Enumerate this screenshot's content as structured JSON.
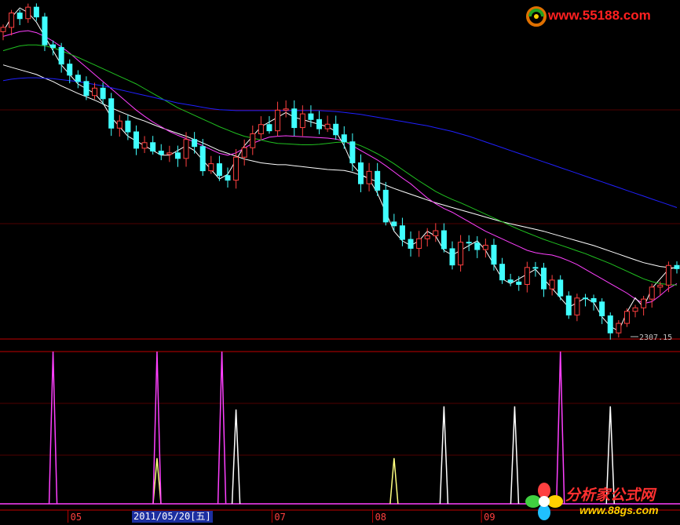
{
  "chart_data": [
    {
      "type": "candlestick",
      "low_label": "2307.15",
      "x_ticks": [
        {
          "label": "05",
          "pos": 0.1
        },
        {
          "label": "07",
          "pos": 0.4
        },
        {
          "label": "08",
          "pos": 0.548
        },
        {
          "label": "09",
          "pos": 0.708
        }
      ],
      "moving_averages": [
        {
          "color": "#ffffff",
          "values": [
            2870,
            2865,
            2860,
            2855,
            2850,
            2842,
            2835,
            2826,
            2818,
            2810,
            2803,
            2796,
            2788,
            2780,
            2772,
            2765,
            2758,
            2752,
            2745,
            2738,
            2732,
            2726,
            2720,
            2713,
            2706,
            2698,
            2690,
            2684,
            2678,
            2672,
            2668,
            2664,
            2662,
            2660,
            2660,
            2658,
            2656,
            2654,
            2652,
            2650,
            2649,
            2648,
            2644,
            2638,
            2631,
            2624,
            2617,
            2610,
            2604,
            2598,
            2592,
            2586,
            2580,
            2575,
            2570,
            2565,
            2560,
            2555,
            2550,
            2545,
            2540,
            2536,
            2532,
            2528,
            2524,
            2520,
            2515,
            2510,
            2505,
            2500,
            2495,
            2490,
            2484,
            2478,
            2472,
            2466,
            2460,
            2454,
            2450,
            2446,
            2444,
            2442
          ]
        },
        {
          "color": "#ff40ff",
          "values": [
            2930,
            2935,
            2940,
            2942,
            2938,
            2930,
            2920,
            2908,
            2895,
            2880,
            2865,
            2850,
            2835,
            2820,
            2805,
            2790,
            2775,
            2762,
            2750,
            2740,
            2730,
            2722,
            2715,
            2708,
            2700,
            2692,
            2684,
            2680,
            2685,
            2695,
            2705,
            2712,
            2718,
            2720,
            2721,
            2720,
            2719,
            2718,
            2717,
            2716,
            2714,
            2710,
            2700,
            2690,
            2680,
            2670,
            2658,
            2645,
            2632,
            2620,
            2605,
            2590,
            2578,
            2568,
            2560,
            2550,
            2540,
            2530,
            2520,
            2512,
            2504,
            2496,
            2488,
            2480,
            2475,
            2472,
            2470,
            2465,
            2458,
            2450,
            2440,
            2430,
            2420,
            2410,
            2400,
            2390,
            2378,
            2368,
            2372,
            2385,
            2400,
            2410
          ]
        },
        {
          "color": "#ffffff",
          "values": [
            2940,
            2970,
            2990,
            2980,
            2960,
            2930,
            2900,
            2870,
            2850,
            2830,
            2820,
            2810,
            2790,
            2760,
            2740,
            2720,
            2710,
            2700,
            2690,
            2680,
            2680,
            2690,
            2700,
            2690,
            2670,
            2650,
            2630,
            2640,
            2670,
            2700,
            2720,
            2740,
            2750,
            2760,
            2770,
            2760,
            2755,
            2750,
            2745,
            2740,
            2730,
            2700,
            2660,
            2640,
            2630,
            2600,
            2560,
            2520,
            2500,
            2490,
            2500,
            2520,
            2510,
            2480,
            2470,
            2480,
            2490,
            2500,
            2480,
            2450,
            2420,
            2410,
            2420,
            2430,
            2440,
            2420,
            2400,
            2380,
            2360,
            2370,
            2380,
            2370,
            2340,
            2320,
            2310,
            2350,
            2380,
            2360,
            2400,
            2420,
            2440,
            2445
          ]
        },
        {
          "color": "#20c020",
          "values": [
            2900,
            2905,
            2910,
            2912,
            2912,
            2910,
            2906,
            2900,
            2893,
            2886,
            2878,
            2870,
            2862,
            2854,
            2846,
            2838,
            2830,
            2820,
            2810,
            2800,
            2790,
            2780,
            2772,
            2764,
            2756,
            2748,
            2740,
            2733,
            2726,
            2720,
            2716,
            2712,
            2708,
            2705,
            2704,
            2703,
            2702,
            2702,
            2703,
            2705,
            2707,
            2708,
            2706,
            2700,
            2692,
            2683,
            2673,
            2662,
            2650,
            2638,
            2626,
            2615,
            2604,
            2595,
            2587,
            2580,
            2572,
            2564,
            2556,
            2548,
            2540,
            2532,
            2524,
            2517,
            2510,
            2503,
            2497,
            2491,
            2485,
            2479,
            2473,
            2466,
            2459,
            2452,
            2444,
            2436,
            2428,
            2420,
            2414,
            2410,
            2408,
            2407
          ]
        },
        {
          "color": "#2020ff",
          "values": [
            2837,
            2840,
            2842,
            2843,
            2843,
            2842,
            2841,
            2839,
            2837,
            2835,
            2832,
            2829,
            2826,
            2822,
            2818,
            2814,
            2810,
            2806,
            2802,
            2798,
            2794,
            2790,
            2787,
            2784,
            2781,
            2778,
            2776,
            2775,
            2774,
            2774,
            2774,
            2774,
            2774,
            2774,
            2774,
            2774,
            2774,
            2774,
            2774,
            2773,
            2772,
            2770,
            2768,
            2766,
            2763,
            2760,
            2757,
            2754,
            2751,
            2748,
            2745,
            2742,
            2738,
            2734,
            2730,
            2725,
            2720,
            2714,
            2708,
            2702,
            2696,
            2690,
            2684,
            2678,
            2672,
            2666,
            2660,
            2654,
            2648,
            2642,
            2636,
            2630,
            2624,
            2618,
            2612,
            2606,
            2600,
            2594,
            2588,
            2582,
            2576,
            2570
          ]
        }
      ]
    },
    {
      "type": "indicator",
      "spikes": [
        {
          "color": "#ff40ff",
          "day": 6,
          "level": 1.0
        },
        {
          "color": "#ffff80",
          "day": 18.5,
          "level": 0.3
        },
        {
          "color": "#ff40ff",
          "day": 18.5,
          "level": 1.0
        },
        {
          "color": "#ff40ff",
          "day": 26.3,
          "level": 1.0
        },
        {
          "color": "#ffffff",
          "day": 28,
          "level": 0.62
        },
        {
          "color": "#ffff80",
          "day": 47,
          "level": 0.3
        },
        {
          "color": "#ffffff",
          "day": 53,
          "level": 0.64
        },
        {
          "color": "#ffffff",
          "day": 61.5,
          "level": 0.64
        },
        {
          "color": "#ff40ff",
          "day": 67,
          "level": 1.0
        },
        {
          "color": "#ffffff",
          "day": 73,
          "level": 0.64
        }
      ]
    }
  ],
  "status": {
    "date": "2011/05/20[五]"
  },
  "watermarks": {
    "top": "www.55188.com",
    "bottom_name": "分析家公式网",
    "bottom_url": "www.88gs.com"
  }
}
